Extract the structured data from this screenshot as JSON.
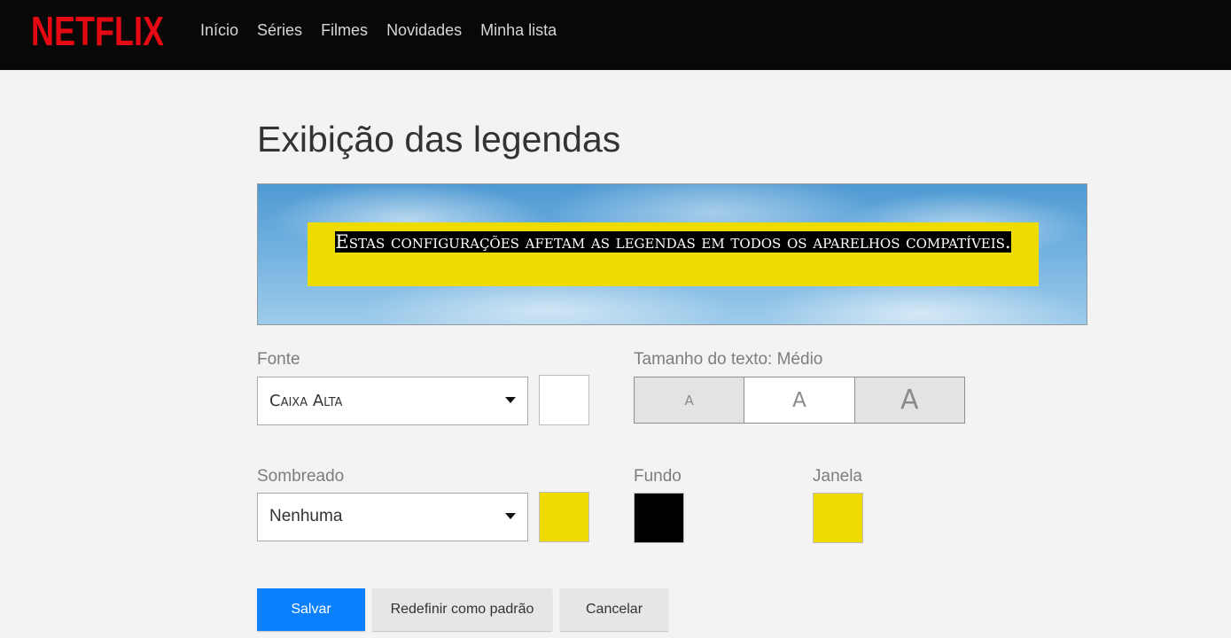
{
  "header": {
    "logo_text": "NETFLIX",
    "nav": [
      "Início",
      "Séries",
      "Filmes",
      "Novidades",
      "Minha lista"
    ]
  },
  "page": {
    "title": "Exibição das legendas",
    "preview_text": "Estas configurações afetam as legendas em todos os aparelhos compatíveis."
  },
  "font": {
    "label": "Fonte",
    "selected": "Caixa Alta",
    "color": "#ffffff"
  },
  "text_size": {
    "label": "Tamanho do texto: Médio",
    "options": [
      "A",
      "A",
      "A"
    ],
    "selected_index": 1
  },
  "shadow": {
    "label": "Sombreado",
    "selected": "Nenhuma",
    "color": "#eedc00"
  },
  "background": {
    "label": "Fundo",
    "color": "#000000"
  },
  "window": {
    "label": "Janela",
    "color": "#eedc00"
  },
  "actions": {
    "save": "Salvar",
    "reset": "Redefinir como padrão",
    "cancel": "Cancelar"
  },
  "colors": {
    "brand": "#e50914",
    "primary": "#0a80ff"
  }
}
